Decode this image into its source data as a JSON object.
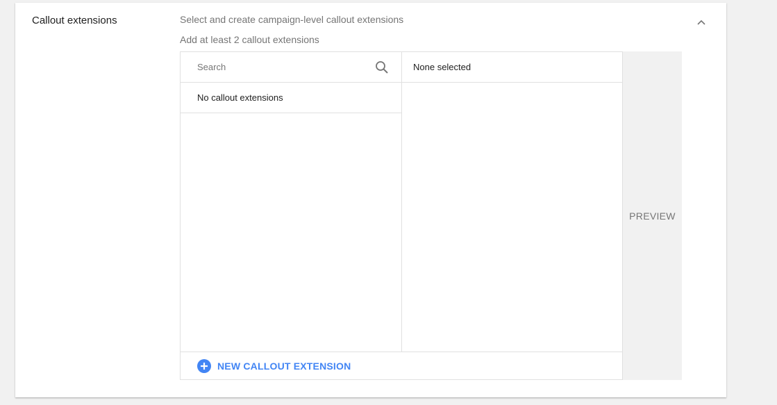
{
  "section": {
    "title": "Callout extensions",
    "description": "Select and create campaign-level callout extensions",
    "hint": "Add at least 2 callout extensions"
  },
  "picker": {
    "search_placeholder": "Search",
    "empty_text": "No callout extensions",
    "selected_header": "None selected",
    "new_button_label": "NEW CALLOUT EXTENSION"
  },
  "preview": {
    "label": "PREVIEW"
  },
  "icons": {
    "collapse": "chevron-up-icon",
    "search": "search-icon",
    "add": "add-circle-icon"
  },
  "colors": {
    "accent": "#4285f4",
    "muted_text": "#757575",
    "border": "#e0e0e0"
  }
}
